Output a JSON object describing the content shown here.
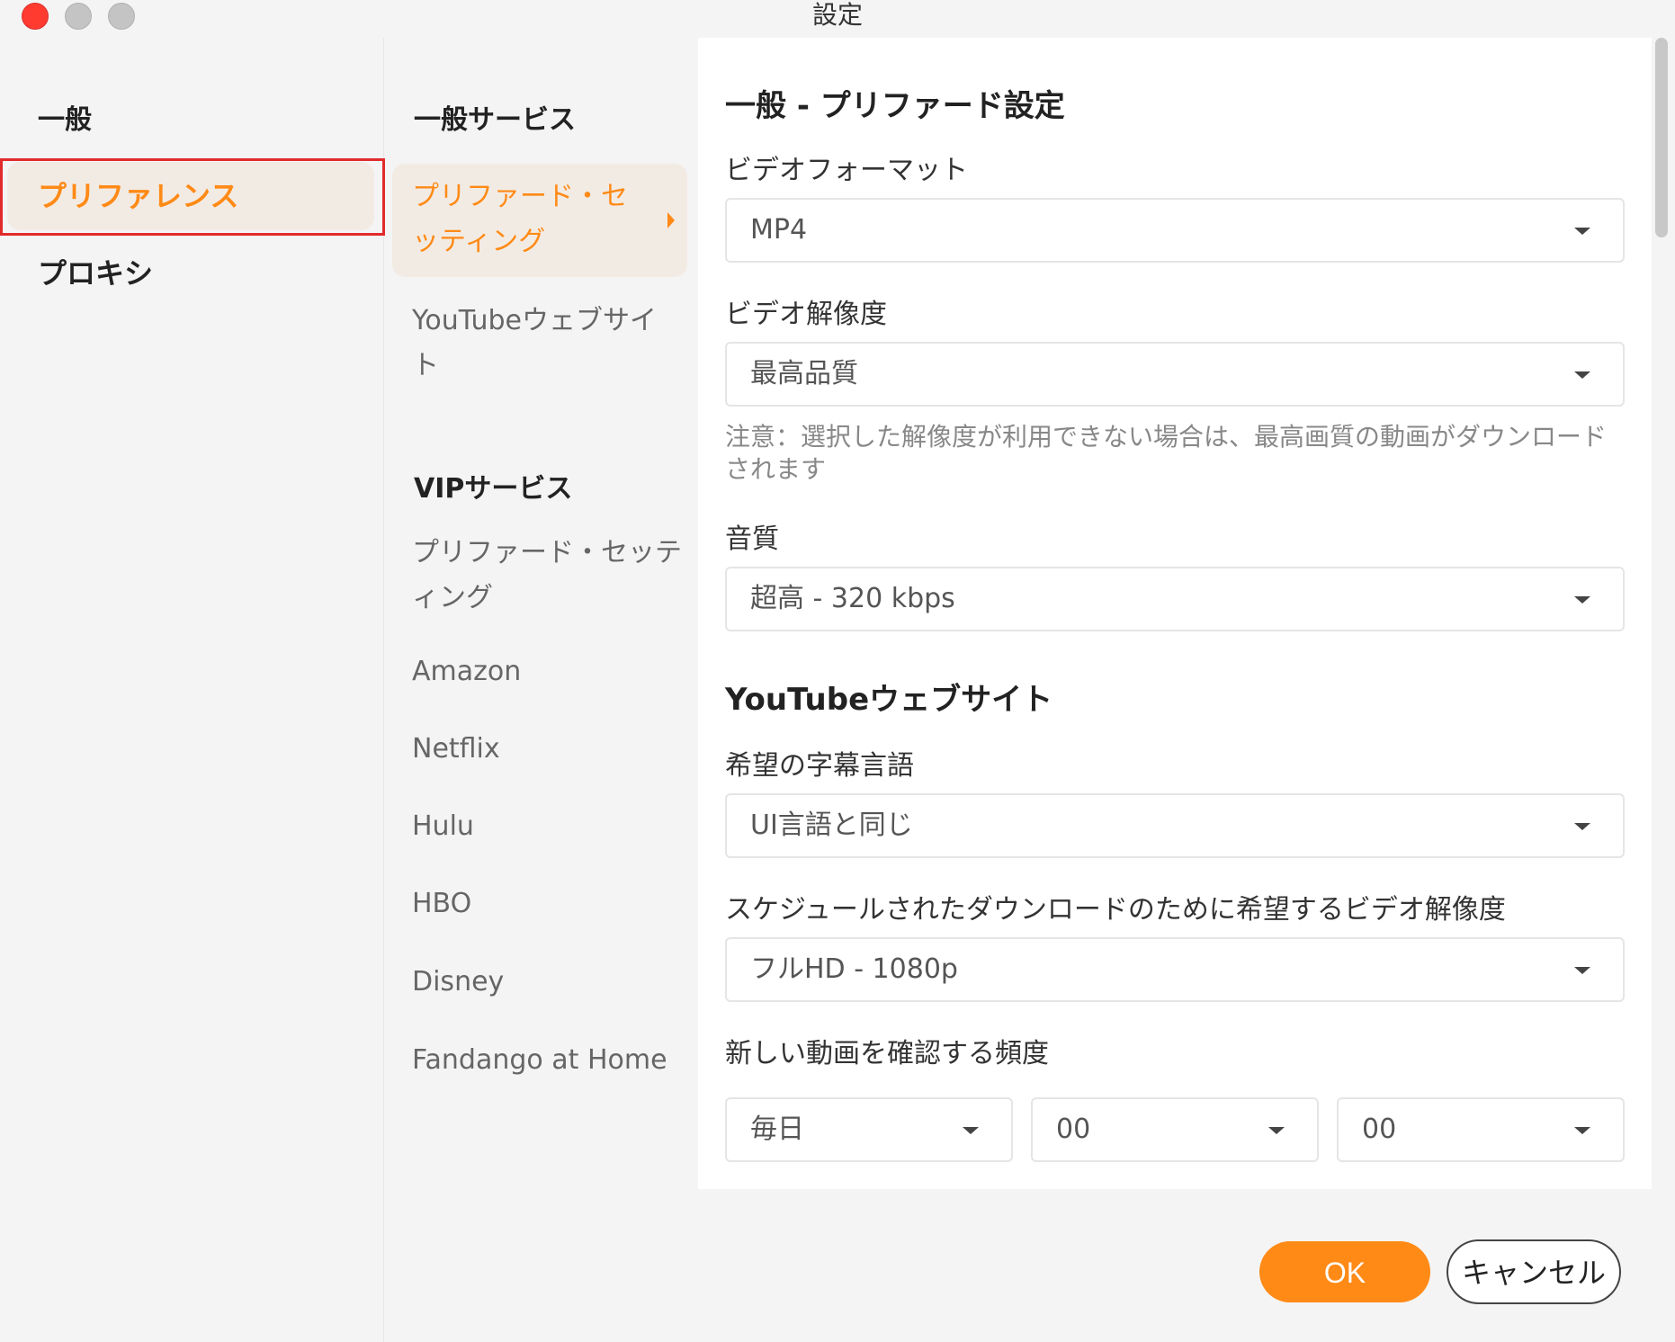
{
  "window": {
    "title": "設定",
    "colors": {
      "close": "#ff3b30",
      "accent": "#ff8a16"
    }
  },
  "sidebar": {
    "heading": "一般",
    "items": [
      {
        "label": "プリファレンス",
        "active": true
      },
      {
        "label": "プロキシ",
        "active": false
      }
    ]
  },
  "submenu": {
    "general_heading": "一般サービス",
    "general_items": [
      {
        "label": "プリファード・セッティング",
        "active": true
      },
      {
        "label": "YouTubeウェブサイト",
        "active": false
      }
    ],
    "vip_heading": "VIPサービス",
    "vip_items": [
      {
        "label": "プリファード・セッティング"
      },
      {
        "label": "Amazon"
      },
      {
        "label": "Netflix"
      },
      {
        "label": "Hulu"
      },
      {
        "label": "HBO"
      },
      {
        "label": "Disney"
      },
      {
        "label": "Fandango at Home"
      }
    ]
  },
  "main": {
    "section1_title": "一般 - プリファード設定",
    "video_format": {
      "label": "ビデオフォーマット",
      "value": "MP4"
    },
    "video_resolution": {
      "label": "ビデオ解像度",
      "value": "最高品質"
    },
    "resolution_note": "注意：選択した解像度が利用できない場合は、最高画質の動画がダウンロードされます",
    "audio_quality": {
      "label": "音質",
      "value": "超高 - 320 kbps"
    },
    "section2_title": "YouTubeウェブサイト",
    "subtitle_language": {
      "label": "希望の字幕言語",
      "value": "UI言語と同じ"
    },
    "scheduled_resolution": {
      "label": "スケジュールされたダウンロードのために希望するビデオ解像度",
      "value": "フルHD - 1080p"
    },
    "check_frequency": {
      "label": "新しい動画を確認する頻度",
      "frequency": "毎日",
      "hour": "00",
      "minute": "00"
    }
  },
  "footer": {
    "ok_label": "OK",
    "cancel_label": "キャンセル"
  }
}
